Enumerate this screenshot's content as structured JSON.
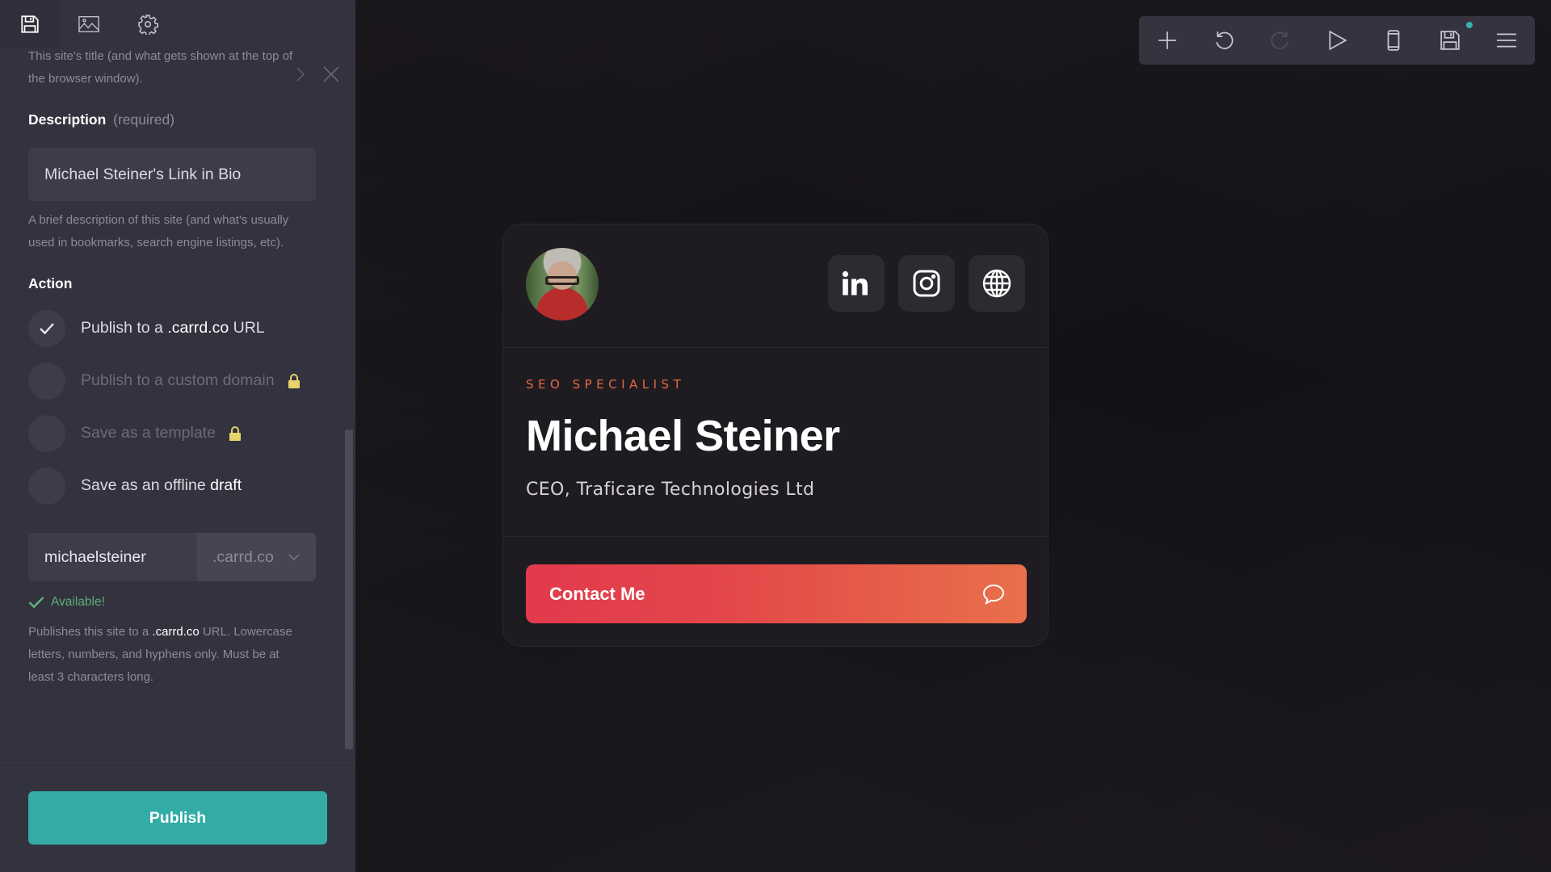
{
  "sidebar": {
    "tabs": [
      {
        "name": "save",
        "icon": "floppy-disk-icon"
      },
      {
        "name": "images",
        "icon": "image-icon"
      },
      {
        "name": "settings",
        "icon": "gear-icon"
      }
    ],
    "title_hint_line1": "This site's title (and what gets shown at the top of",
    "title_hint_line2": "the browser window).",
    "description": {
      "label": "Description",
      "required": "(required)",
      "value": "Michael Steiner's Link in Bio",
      "hint_line1": "A brief description of this site (and what's usually",
      "hint_line2": "used in bookmarks, search engine listings, etc)."
    },
    "action": {
      "label": "Action",
      "options": [
        {
          "pre": "Publish to a ",
          "hl": ".carrd.co",
          "post": " URL",
          "selected": true,
          "disabled": false,
          "locked": false
        },
        {
          "pre": "Publish to a custom domain",
          "hl": "",
          "post": "",
          "selected": false,
          "disabled": true,
          "locked": true
        },
        {
          "pre": "Save as a template",
          "hl": "",
          "post": "",
          "selected": false,
          "disabled": true,
          "locked": true
        },
        {
          "pre": "Save as an offline ",
          "hl": "draft",
          "post": "",
          "selected": false,
          "disabled": false,
          "locked": false
        }
      ]
    },
    "url": {
      "value": "michaelsteiner",
      "domain": ".carrd.co",
      "status": "Available!",
      "hint_pre": "Publishes this site to a ",
      "hint_hl": ".carrd.co",
      "hint_post": " URL. Lowercase",
      "hint_line2": "letters, numbers, and hyphens only. Must be at",
      "hint_line3": "least 3 characters long."
    },
    "publish_label": "Publish"
  },
  "toolbar": {
    "buttons": [
      "plus-icon",
      "undo-icon",
      "redo-icon",
      "play-icon",
      "mobile-icon",
      "save-icon",
      "menu-icon"
    ]
  },
  "card": {
    "kicker": "SEO SPECIALIST",
    "name": "Michael Steiner",
    "role": "CEO, Traficare Technologies Ltd",
    "socials": [
      "linkedin",
      "instagram",
      "website"
    ],
    "contact_label": "Contact Me"
  },
  "colors": {
    "accent": "#33aca6",
    "status_ok": "#5fae79",
    "lock": "#e6d36a",
    "kicker": "#e06a45",
    "cta_start": "#e23a4c",
    "cta_end": "#e8704a"
  }
}
